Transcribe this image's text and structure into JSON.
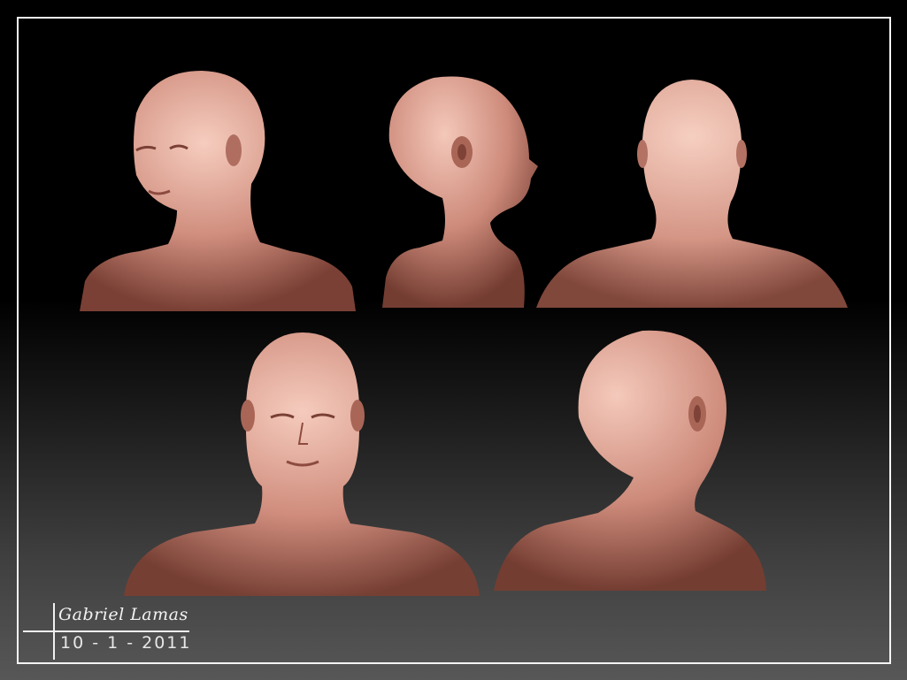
{
  "artwork": {
    "views": [
      {
        "id": "three-quarter-front",
        "label": ""
      },
      {
        "id": "side-profile",
        "label": ""
      },
      {
        "id": "back",
        "label": ""
      },
      {
        "id": "front",
        "label": ""
      },
      {
        "id": "three-quarter-back",
        "label": ""
      }
    ],
    "signature": {
      "name": "Gabriel Lamas",
      "date": "10 - 1 - 2011"
    }
  },
  "colors": {
    "skin_light": "#f0c2b4",
    "skin_mid": "#c98373",
    "skin_dark": "#6e3a30",
    "frame_border": "#f4f4f4",
    "background_top": "#000000",
    "background_bottom": "#575757"
  }
}
